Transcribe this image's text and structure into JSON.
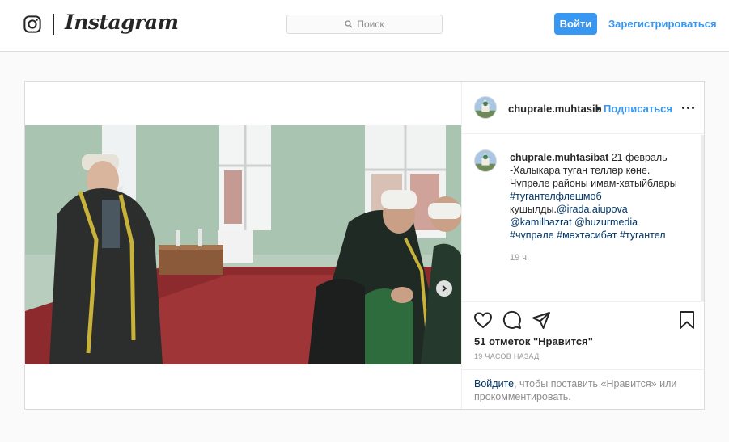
{
  "header": {
    "logo_text": "Instagram",
    "search_placeholder": "Поиск",
    "login_label": "Войти",
    "signup_label": "Зарегистрироваться"
  },
  "post": {
    "username": "chuprale.muhtasib",
    "separator": "•",
    "follow_label": "Подписаться",
    "caption": {
      "username": "chuprale.muhtasibat",
      "date": "21 февраль",
      "line1": "-Халыкара туган телләр көне.",
      "line2": "Чүпрәле районы имам-хатыйблары",
      "hashtag1": "#тугантелфлешмоб",
      "line3_prefix": "кушылды.",
      "mention1": "@irada.aiupova",
      "mention2": "@kamilhazrat",
      "mention3": "@huzurmedia",
      "hashtag2": "#чүпрәле",
      "hashtag3": "#мөхтәсибәт",
      "hashtag4": "#тугантел",
      "time": "19 ч."
    },
    "likes_text": "51 отметок \"Нравится\"",
    "posted_ago": "19 ЧАСОВ НАЗАД",
    "footer": {
      "login_link": "Войдите",
      "rest": ", чтобы поставить «Нравится» или прокомментировать."
    },
    "carousel": {
      "current": 1,
      "total": 2
    }
  },
  "icons": [
    "instagram-icon",
    "search-icon",
    "chevron-right-icon",
    "more-icon",
    "heart-icon",
    "comment-icon",
    "share-icon",
    "bookmark-icon"
  ]
}
